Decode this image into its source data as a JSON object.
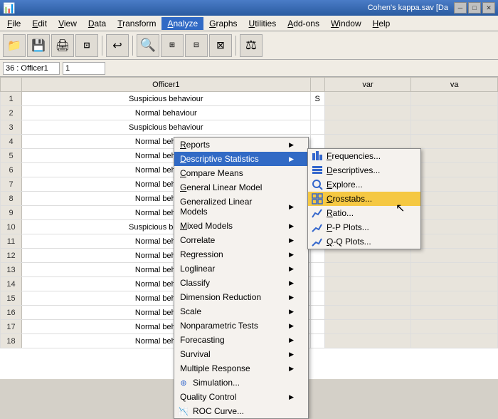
{
  "titlebar": {
    "title": "Cohen's kappa.sav [Da",
    "icon": "📊"
  },
  "menubar": {
    "items": [
      "File",
      "Edit",
      "View",
      "Data",
      "Transform",
      "Analyze",
      "Graphs",
      "Utilities",
      "Add-ons",
      "Window",
      "Help"
    ]
  },
  "varbar": {
    "varname": "36 : Officer1",
    "varval": "1"
  },
  "grid": {
    "col_header": "Officer1",
    "rows": [
      {
        "num": "1",
        "val": "Suspicious behaviour",
        "s": "S"
      },
      {
        "num": "2",
        "val": "Normal behaviour",
        "s": ""
      },
      {
        "num": "3",
        "val": "Suspicious behaviour",
        "s": ""
      },
      {
        "num": "4",
        "val": "Normal behaviour",
        "s": ""
      },
      {
        "num": "5",
        "val": "Normal behaviour",
        "s": ""
      },
      {
        "num": "6",
        "val": "Normal behaviour",
        "s": ""
      },
      {
        "num": "7",
        "val": "Normal behaviour",
        "s": ""
      },
      {
        "num": "8",
        "val": "Normal behaviour",
        "s": ""
      },
      {
        "num": "9",
        "val": "Normal behaviour",
        "s": ""
      },
      {
        "num": "10",
        "val": "Suspicious behaviour",
        "s": ""
      },
      {
        "num": "11",
        "val": "Normal behaviour",
        "s": ""
      },
      {
        "num": "12",
        "val": "Normal behaviour",
        "s": ""
      },
      {
        "num": "13",
        "val": "Normal behaviour",
        "s": ""
      },
      {
        "num": "14",
        "val": "Normal behaviour",
        "s": ""
      },
      {
        "num": "15",
        "val": "Normal behaviour",
        "s": ""
      },
      {
        "num": "16",
        "val": "Normal behaviour",
        "s": ""
      },
      {
        "num": "17",
        "val": "Normal behaviour",
        "s": ""
      },
      {
        "num": "18",
        "val": "Normal behaviour",
        "s": ""
      }
    ]
  },
  "analyze_menu": {
    "items": [
      {
        "label": "Reports",
        "has_arrow": true,
        "underline_idx": 0
      },
      {
        "label": "Descriptive Statistics",
        "has_arrow": true,
        "active": true,
        "underline_idx": 0
      },
      {
        "label": "Compare Means",
        "has_arrow": false
      },
      {
        "label": "General Linear Model",
        "has_arrow": false
      },
      {
        "label": "Generalized Linear Models",
        "has_arrow": true
      },
      {
        "label": "Mixed Models",
        "has_arrow": true
      },
      {
        "label": "Correlate",
        "has_arrow": true
      },
      {
        "label": "Regression",
        "has_arrow": true
      },
      {
        "label": "Loglinear",
        "has_arrow": true
      },
      {
        "label": "Classify",
        "has_arrow": true
      },
      {
        "label": "Dimension Reduction",
        "has_arrow": true
      },
      {
        "label": "Scale",
        "has_arrow": true
      },
      {
        "label": "Nonparametric Tests",
        "has_arrow": true
      },
      {
        "label": "Forecasting",
        "has_arrow": true
      },
      {
        "label": "Survival",
        "has_arrow": true
      },
      {
        "label": "Multiple Response",
        "has_arrow": true
      },
      {
        "label": "Simulation...",
        "has_icon": true,
        "icon": "🔵"
      },
      {
        "label": "Quality Control",
        "has_arrow": true
      },
      {
        "label": "ROC Curve...",
        "has_icon": true,
        "icon": "📉"
      }
    ]
  },
  "desc_stats_menu": {
    "items": [
      {
        "label": "Frequencies...",
        "icon": "📊",
        "icon_color": "blue"
      },
      {
        "label": "Descriptives...",
        "icon": "📋",
        "icon_color": "blue"
      },
      {
        "label": "Explore...",
        "icon": "🔍",
        "icon_color": "blue"
      },
      {
        "label": "Crosstabs...",
        "icon": "⊞",
        "icon_color": "blue",
        "highlighted": true
      },
      {
        "label": "Ratio...",
        "icon": "📈",
        "icon_color": "blue"
      },
      {
        "label": "P-P Plots...",
        "icon": "📉",
        "icon_color": "blue"
      },
      {
        "label": "Q-Q Plots...",
        "icon": "📉",
        "icon_color": "blue"
      }
    ]
  }
}
